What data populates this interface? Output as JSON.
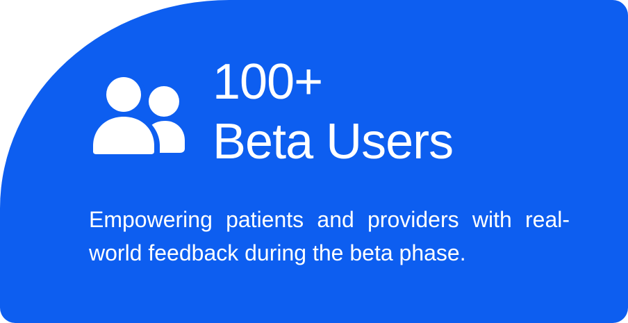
{
  "card": {
    "background_color": "#0d5ef0",
    "icon": "users-icon",
    "stat_value": "100+",
    "stat_label": "Beta Users",
    "description": "Empowering patients and providers with real-world feedback during the beta phase."
  }
}
